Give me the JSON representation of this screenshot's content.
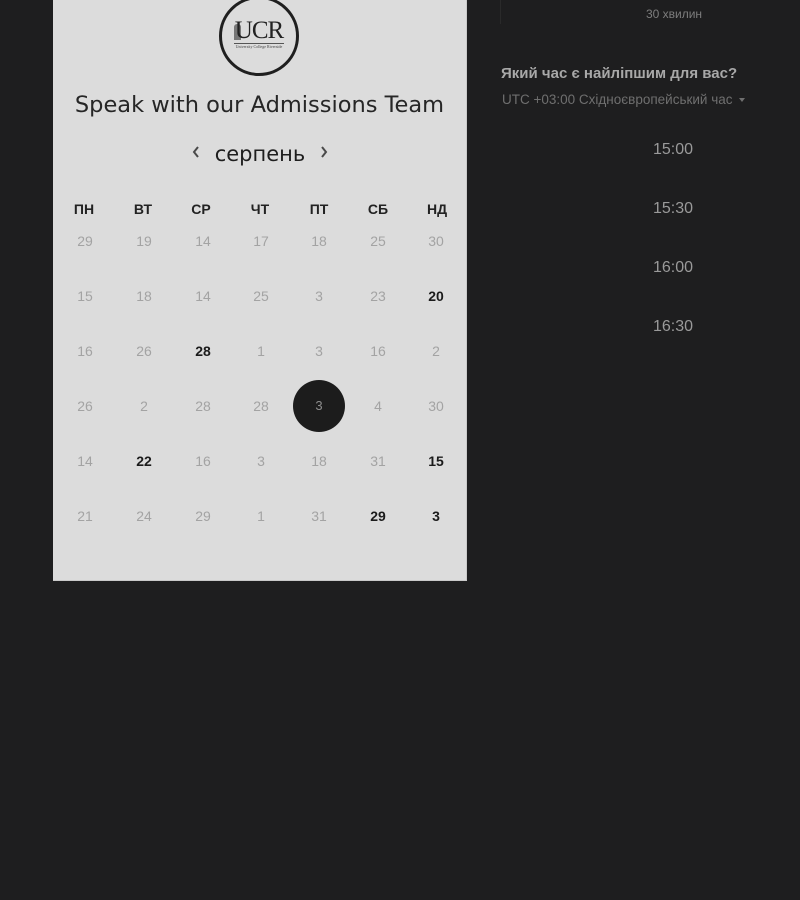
{
  "header": {
    "logo_text": "UCR",
    "logo_subtitle": "University College Riverside",
    "title": "Speak with our Admissions Team"
  },
  "calendar": {
    "month": "серпень",
    "weekdays": [
      "ПН",
      "ВТ",
      "СР",
      "ЧТ",
      "ПТ",
      "СБ",
      "НД"
    ],
    "weeks": [
      [
        "29",
        "19",
        "14",
        "17",
        "18",
        "25",
        "30"
      ],
      [
        "15",
        "18",
        "14",
        "25",
        "3",
        "23",
        "20"
      ],
      [
        "16",
        "26",
        "28",
        "1",
        "3",
        "16",
        "2"
      ],
      [
        "26",
        "2",
        "28",
        "28",
        "3",
        "4",
        "30"
      ],
      [
        "14",
        "22",
        "16",
        "3",
        "18",
        "31",
        "15"
      ],
      [
        "21",
        "24",
        "29",
        "1",
        "31",
        "29",
        "3"
      ]
    ],
    "available": [
      [
        1,
        6
      ],
      [
        2,
        2
      ],
      [
        4,
        1
      ],
      [
        4,
        6
      ],
      [
        5,
        5
      ],
      [
        5,
        6
      ]
    ],
    "selected": [
      3,
      4
    ]
  },
  "booking": {
    "duration": "30 хвилин",
    "question": "Який час є найліпшим для вас?",
    "timezone": "UTC +03:00 Східноєвропейський час",
    "slots": [
      "15:00",
      "15:30",
      "16:00",
      "16:30"
    ]
  },
  "colors": {
    "page_background": "#1e1e1f",
    "card_background": "#dcdcdc",
    "selected_day": "#1c1c1c"
  }
}
